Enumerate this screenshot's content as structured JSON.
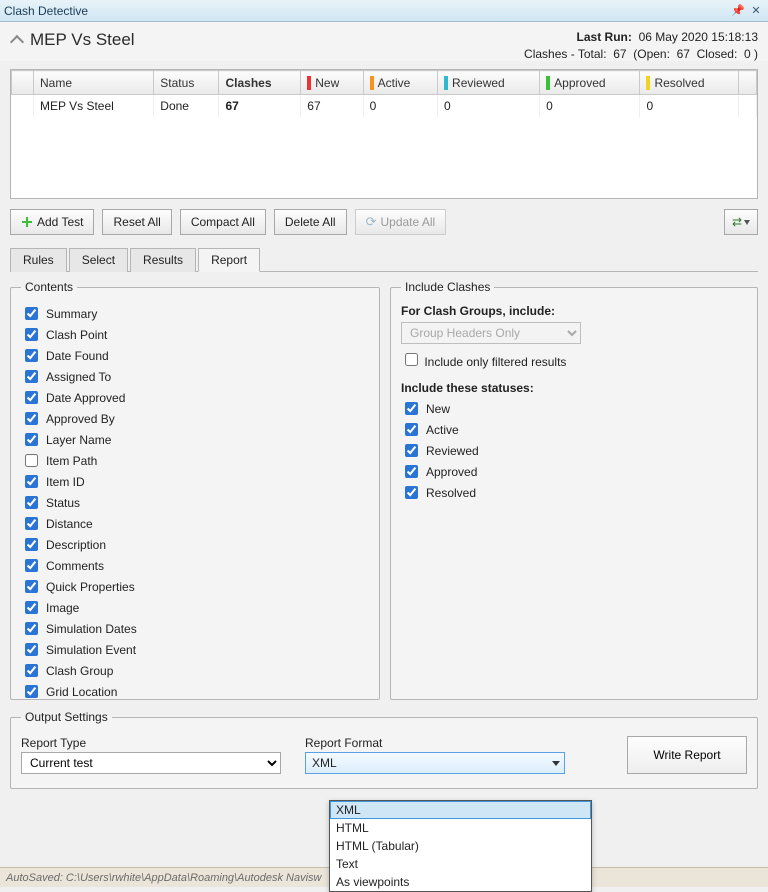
{
  "window": {
    "title": "Clash Detective"
  },
  "header": {
    "test_name": "MEP Vs Steel",
    "last_run_label": "Last Run:",
    "last_run_value": "06 May 2020 15:18:13",
    "summary_label": "Clashes - Total:",
    "total": "67",
    "open_label": "(Open:",
    "open": "67",
    "closed_label": "Closed:",
    "closed": "0 )"
  },
  "grid": {
    "cols": {
      "name": "Name",
      "status": "Status",
      "clashes": "Clashes",
      "new": "New",
      "active": "Active",
      "reviewed": "Reviewed",
      "approved": "Approved",
      "resolved": "Resolved"
    },
    "row": {
      "name": "MEP Vs Steel",
      "status": "Done",
      "clashes": "67",
      "new": "67",
      "active": "0",
      "reviewed": "0",
      "approved": "0",
      "resolved": "0"
    }
  },
  "buttons": {
    "add_test": "Add Test",
    "reset_all": "Reset All",
    "compact_all": "Compact All",
    "delete_all": "Delete All",
    "update_all": "Update All"
  },
  "tabs": {
    "rules": "Rules",
    "select": "Select",
    "results": "Results",
    "report": "Report"
  },
  "contents": {
    "legend": "Contents",
    "items": [
      {
        "label": "Summary",
        "checked": true
      },
      {
        "label": "Clash Point",
        "checked": true
      },
      {
        "label": "Date Found",
        "checked": true
      },
      {
        "label": "Assigned To",
        "checked": true
      },
      {
        "label": "Date Approved",
        "checked": true
      },
      {
        "label": "Approved By",
        "checked": true
      },
      {
        "label": "Layer Name",
        "checked": true
      },
      {
        "label": "Item Path",
        "checked": false
      },
      {
        "label": "Item ID",
        "checked": true
      },
      {
        "label": "Status",
        "checked": true
      },
      {
        "label": "Distance",
        "checked": true
      },
      {
        "label": "Description",
        "checked": true
      },
      {
        "label": "Comments",
        "checked": true
      },
      {
        "label": "Quick Properties",
        "checked": true
      },
      {
        "label": "Image",
        "checked": true
      },
      {
        "label": "Simulation Dates",
        "checked": true
      },
      {
        "label": "Simulation Event",
        "checked": true
      },
      {
        "label": "Clash Group",
        "checked": true
      },
      {
        "label": "Grid Location",
        "checked": true
      }
    ]
  },
  "include": {
    "legend": "Include Clashes",
    "groups_label": "For Clash Groups, include:",
    "groups_value": "Group Headers Only",
    "only_filtered": "Include only filtered results",
    "statuses_label": "Include these statuses:",
    "statuses": [
      {
        "label": "New",
        "checked": true
      },
      {
        "label": "Active",
        "checked": true
      },
      {
        "label": "Reviewed",
        "checked": true
      },
      {
        "label": "Approved",
        "checked": true
      },
      {
        "label": "Resolved",
        "checked": true
      }
    ]
  },
  "output": {
    "legend": "Output Settings",
    "report_type_label": "Report Type",
    "report_type_value": "Current test",
    "report_format_label": "Report Format",
    "report_format_value": "XML",
    "write_report": "Write Report",
    "format_options": [
      "XML",
      "HTML",
      "HTML (Tabular)",
      "Text",
      "As viewpoints"
    ]
  },
  "statusbar": "AutoSaved: C:\\Users\\rwhite\\AppData\\Roaming\\Autodesk Navisw"
}
